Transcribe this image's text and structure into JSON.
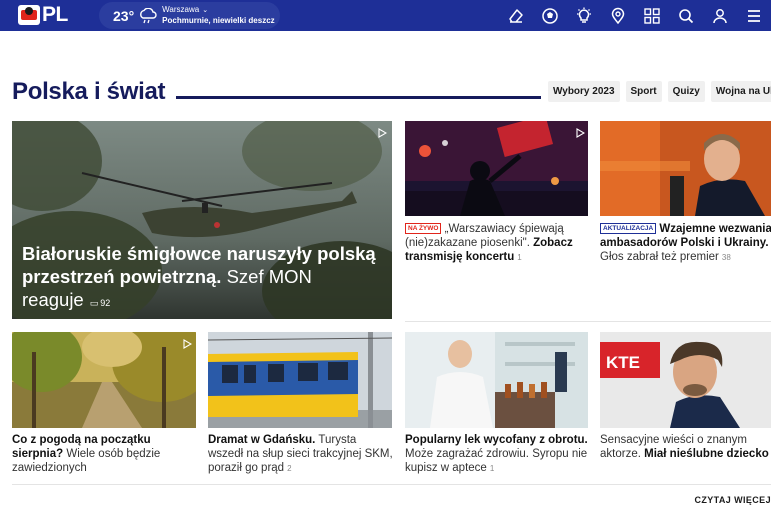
{
  "header": {
    "logo": "PL",
    "weather": {
      "temp": "23°",
      "city": "Warszawa",
      "desc": "Pochmurnie, niewielki deszcz"
    },
    "icons": [
      "eraser-icon",
      "ball-icon",
      "bulb-icon",
      "location-icon",
      "apps-icon",
      "search-icon",
      "user-icon",
      "menu-icon"
    ]
  },
  "section": {
    "title": "Polska i świat",
    "tags": [
      "Wybory 2023",
      "Sport",
      "Quizy",
      "Wojna na Ukrainie"
    ]
  },
  "hero": {
    "bold": "Białoruskie śmigłowce naruszyły polską przestrzeń powietrzną.",
    "rest": "Szef MON reaguje",
    "comments": "92"
  },
  "cards": [
    {
      "badge": "NA ŻYWO",
      "lead": "„Warszawiacy śpiewają (nie)zakazane piosenki\".",
      "bold": "Zobacz transmisję koncertu",
      "comments": "1"
    },
    {
      "badge": "AKTUALIZACJA",
      "bold": "Wzajemne wezwania ambasadorów Polski i Ukrainy.",
      "rest": "Głos zabrał też premier",
      "comments": "38"
    },
    {
      "bold": "Co z pogodą na początku sierpnia?",
      "rest": "Wiele osób będzie zawiedzionych"
    },
    {
      "bold": "Dramat w Gdańsku.",
      "rest": "Turysta wszedł na słup sieci trakcyjnej SKM, poraził go prąd",
      "comments": "2"
    },
    {
      "bold": "Popularny lek wycofany z obrotu.",
      "rest": "Może zagrażać zdrowiu. Syropu nie kupisz w aptece",
      "comments": "1"
    },
    {
      "lead": "Sensacyjne wieści o znanym aktorze.",
      "bold": "Miał nieślubne dziecko"
    }
  ],
  "readmore": "CZYTAJ WIĘCEJ"
}
